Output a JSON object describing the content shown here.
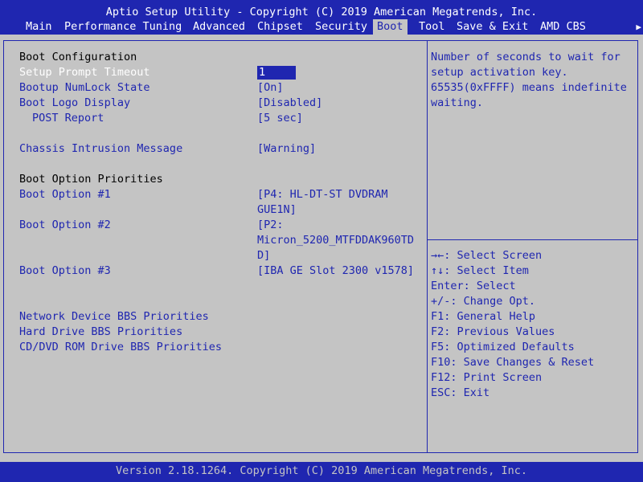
{
  "header": {
    "title": "Aptio Setup Utility - Copyright (C) 2019 American Megatrends, Inc.",
    "tabs": [
      "Main",
      "Performance Tuning",
      "Advanced",
      "Chipset",
      "Security",
      "Boot",
      "Tool",
      "Save & Exit",
      "AMD CBS"
    ],
    "active_tab": "Boot",
    "scroll_right": "▶"
  },
  "boot": {
    "boot_configuration": "Boot Configuration",
    "setup_prompt_timeout": {
      "label": "Setup Prompt Timeout",
      "value": "1"
    },
    "bootup_numlock": {
      "label": "Bootup NumLock State",
      "value": "[On]"
    },
    "boot_logo": {
      "label": "Boot Logo Display",
      "value": "[Disabled]"
    },
    "post_report": {
      "label": "POST Report",
      "value": "[5 sec]"
    },
    "chassis_intrusion": {
      "label": "Chassis Intrusion Message",
      "value": "[Warning]"
    },
    "boot_option_priorities": "Boot Option Priorities",
    "boot_option_1": {
      "label": "Boot Option #1",
      "value_line1": "[P4: HL-DT-ST DVDRAM",
      "value_line2": "GUE1N]"
    },
    "boot_option_2": {
      "label": "Boot Option #2",
      "value_line1": "[P2:",
      "value_line2": "Micron_5200_MTFDDAK960TD",
      "value_line3": "D]"
    },
    "boot_option_3": {
      "label": "Boot Option #3",
      "value": "[IBA GE Slot 2300 v1578]"
    },
    "network_bbs": "Network Device BBS Priorities",
    "hdd_bbs": "Hard Drive BBS Priorities",
    "cdrom_bbs": "CD/DVD ROM Drive BBS Priorities"
  },
  "help": {
    "lines": [
      "Number of seconds to wait for",
      "setup activation key.",
      "65535(0xFFFF) means indefinite",
      "waiting."
    ]
  },
  "keys": [
    "→←: Select Screen",
    "↑↓: Select Item",
    "Enter: Select",
    "+/-: Change Opt.",
    "F1: General Help",
    "F2: Previous Values",
    "F5: Optimized Defaults",
    "F10: Save Changes & Reset",
    "F12: Print Screen",
    "ESC: Exit"
  ],
  "footer": "Version 2.18.1264. Copyright (C) 2019 American Megatrends, Inc.",
  "colors": {
    "blue": "#1f26b0",
    "grey": "#c4c4c4",
    "white": "#ffffff"
  }
}
